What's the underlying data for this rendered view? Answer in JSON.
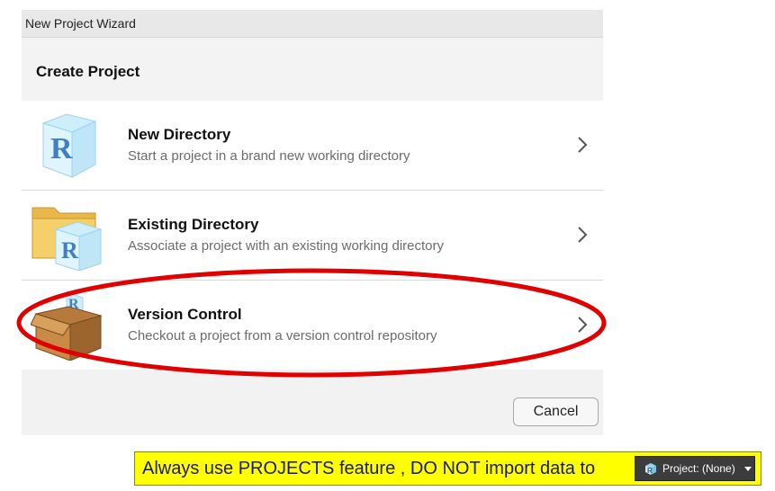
{
  "dialog": {
    "window_title": "New Project Wizard",
    "header_title": "Create Project",
    "options": [
      {
        "title": "New Directory",
        "description": "Start a project in a brand new working directory",
        "icon": "r-cube-icon"
      },
      {
        "title": "Existing Directory",
        "description": "Associate a project with an existing working directory",
        "icon": "folder-r-icon"
      },
      {
        "title": "Version Control",
        "description": "Checkout a project from a version control repository",
        "icon": "box-icon"
      }
    ],
    "cancel_label": "Cancel"
  },
  "annotation": {
    "banner_text": "Always use PROJECTS feature , DO NOT import data to",
    "project_chip_label": "Project: (None)",
    "banner_color": "#ffff00",
    "highlight_color": "#e00000"
  }
}
